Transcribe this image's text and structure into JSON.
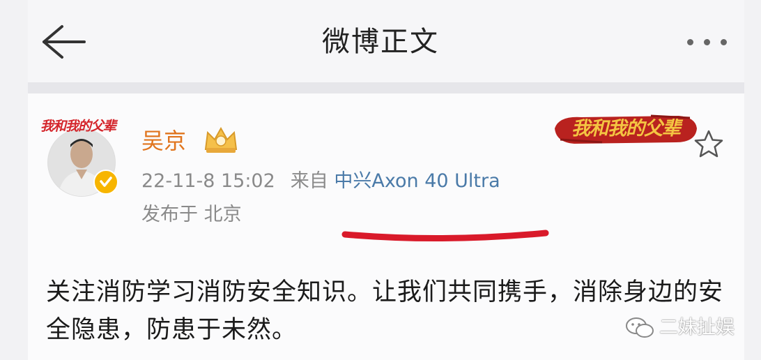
{
  "header": {
    "title": "微博正文",
    "back_icon": "arrow-left-icon",
    "more_icon": "more-dots-icon"
  },
  "post": {
    "avatar_frame_text": "我和我的父辈",
    "username": "吴京",
    "timestamp": "22-11-8 15:02",
    "source_prefix": "来自",
    "device": "中兴Axon 40 Ultra",
    "location": "发布于 北京",
    "banner_text": "我和我的父辈",
    "content": "关注消防学习消防安全知识。让我们共同携手，消除身边的安全隐患，防患于未然。"
  },
  "watermark": {
    "text": "二妹扯娱"
  },
  "colors": {
    "username": "#e0741d",
    "device_link": "#4a7aa8",
    "meta_text": "#8a8a8a",
    "underline_mark": "#d91a2a",
    "verified_badge": "#f7b500"
  }
}
